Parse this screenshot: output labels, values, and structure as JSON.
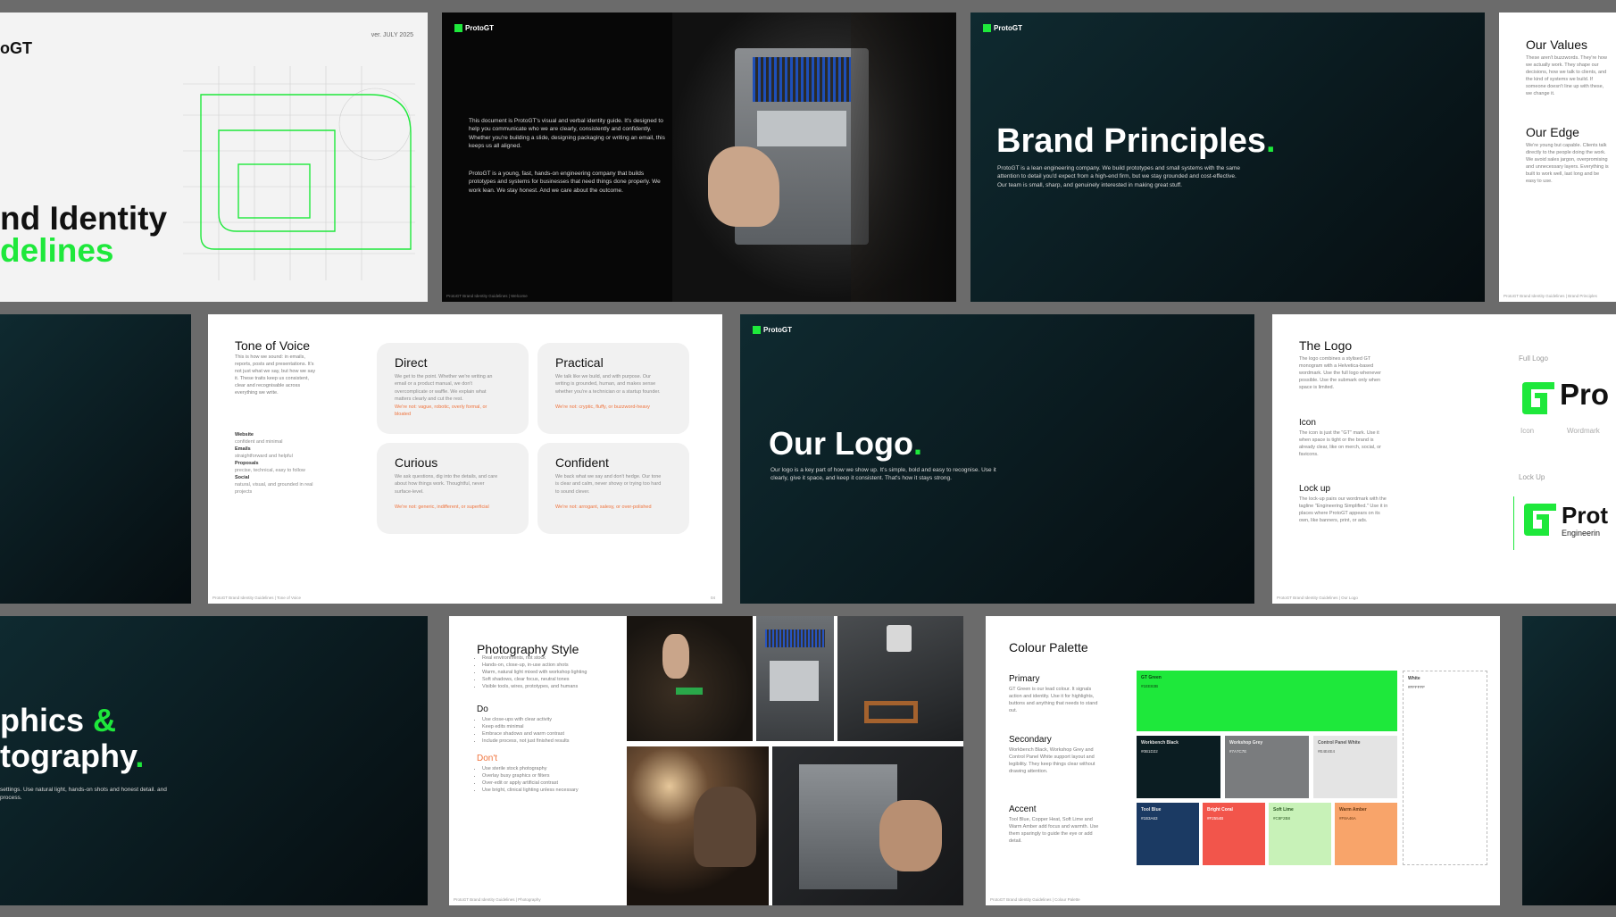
{
  "cover": {
    "logo_fragment": "oGT",
    "version": "ver. JULY 2025",
    "title_line1": "nd Identity",
    "title_line2": "delines"
  },
  "intro": {
    "logo": "ProtoGT",
    "para1": "This document is ProtoGT's visual and verbal identity guide. It's designed to help you communicate who we are clearly, consistently and confidently. Whether you're building a slide, designing packaging or writing an email, this keeps us all aligned.",
    "para2": "ProtoGT is a young, fast, hands-on engineering company that builds prototypes and systems for businesses that need things done properly. We work lean. We stay honest. And we care about the outcome.",
    "footer": "ProtoGT Brand Identity Guidelines | Welcome"
  },
  "principles": {
    "logo": "ProtoGT",
    "title": "Brand Principles",
    "dot": ".",
    "body": "ProtoGT is a lean engineering company. We build prototypes and small systems with the same attention to detail you'd expect from a high-end firm, but we stay grounded and cost-effective. Our team is small, sharp, and genuinely interested in making great stuff."
  },
  "values": {
    "h1": "Our Values",
    "p1": "These aren't buzzwords. They're how we actually work. They shape our decisions, how we talk to clients, and the kind of systems we build. If someone doesn't line up with these, we change it.",
    "h2": "Our Edge",
    "p2": "We're young but capable. Clients talk directly to the people doing the work. We avoid sales jargon, overpromising and unnecessary layers. Everything is built to work well, last long and be easy to use.",
    "footer": "ProtoGT Brand Identity Guidelines | Brand Principles"
  },
  "tone": {
    "title": "Tone of Voice",
    "intro": "This is how we sound: in emails, reports, posts and presentations. It's not just what we say, but how we say it. These traits keep us consistent, clear and recognisable across everything we write.",
    "channels": [
      {
        "name": "Website",
        "desc": "confident and minimal"
      },
      {
        "name": "Emails",
        "desc": "straightforward and helpful"
      },
      {
        "name": "Proposals",
        "desc": "precise, technical, easy to follow"
      },
      {
        "name": "Social",
        "desc": "natural, visual, and grounded in real projects"
      }
    ],
    "cards": [
      {
        "title": "Direct",
        "desc": "We get to the point. Whether we're writing an email or a product manual, we don't overcomplicate or waffle. We explain what matters clearly and cut the rest.",
        "not": "We're not: vague, robotic, overly formal, or bloated"
      },
      {
        "title": "Practical",
        "desc": "We talk like we build, and with purpose. Our writing is grounded, human, and makes sense whether you're a technician or a startup founder.",
        "not": "We're not: cryptic, fluffy, or buzzword-heavy"
      },
      {
        "title": "Curious",
        "desc": "We ask questions, dig into the details, and care about how things work. Thoughtful, never surface-level.",
        "not": "We're not: generic, indifferent, or superficial"
      },
      {
        "title": "Confident",
        "desc": "We back what we say and don't hedge. Our tone is clear and calm, never showy or trying too hard to sound clever.",
        "not": "We're not: arrogant, salesy, or over-polished"
      }
    ],
    "footer": "ProtoGT Brand Identity Guidelines | Tone of Voice",
    "page": "04"
  },
  "ourlogo": {
    "logo": "ProtoGT",
    "title": "Our Logo",
    "dot": ".",
    "body": "Our logo is a key part of how we show up. It's simple, bold and easy to recognise. Use it clearly, give it space, and keep it consistent. That's how it stays strong."
  },
  "thelogo": {
    "title": "The Logo",
    "p1": "The logo combines a stylised GT monogram with a Helvetica-based wordmark. Use the full logo whenever possible. Use the submark only when space is limited.",
    "icon_h": "Icon",
    "icon_p": "The icon is just the \"GT\" mark. Use it when space is tight or the brand is already clear, like on merch, social, or favicons.",
    "lockup_h": "Lock up",
    "lockup_p": "The lock-up pairs our wordmark with the tagline \"Engineering Simplified.\" Use it in places where ProtoGT appears on its own, like banners, print, or ads.",
    "full_logo_label": "Full Logo",
    "mark_text": "Pro",
    "icon_label": "Icon",
    "wordmark_label": "Wordmark",
    "lockup_label": "Lock Up",
    "lockup_text": "Prot",
    "lockup_tag": "Engineerin",
    "footer": "ProtoGT Brand Identity Guidelines | Our Logo"
  },
  "graphics": {
    "line1": "phics ",
    "amp": "&",
    "line2": "tography",
    "dot": ".",
    "body": "settings. Use natural light, hands-on shots and honest detail. and process."
  },
  "photography": {
    "title": "Photography Style",
    "list1": [
      "Real environments, not stock",
      "Hands-on, close-up, in-use action shots",
      "Warm, natural light mixed with workshop lighting",
      "Soft shadows, clear focus, neutral tones",
      "Visible tools, wires, prototypes, and humans"
    ],
    "do_h": "Do",
    "list2": [
      "Use close-ups with clear activity",
      "Keep edits minimal",
      "Embrace shadows and warm contrast",
      "Include process, not just finished results"
    ],
    "dont_h": "Don't",
    "list3": [
      "Use sterile stock photography",
      "Overlay busy graphics or filters",
      "Over-edit or apply artificial contrast",
      "Use bright, clinical lighting unless necessary"
    ],
    "footer": "ProtoGT Brand Identity Guidelines | Photography"
  },
  "palette": {
    "title": "Colour Palette",
    "primary_h": "Primary",
    "primary_p": "GT Green is our lead colour. It signals action and identity. Use it for highlights, buttons and anything that needs to stand out.",
    "secondary_h": "Secondary",
    "secondary_p": "Workbench Black, Workshop Grey and Control Panel White support layout and legibility. They keep things clear without drawing attention.",
    "accent_h": "Accent",
    "accent_p": "Tool Blue, Copper Heat, Soft Lime and Warm Amber add focus and warmth. Use them sparingly to guide the eye or add detail.",
    "swatches": {
      "gtgreen": {
        "name": "GT Green",
        "codes": "#1EE83B"
      },
      "white": {
        "name": "White",
        "codes": "#FFFFFF"
      },
      "workbench": {
        "name": "Workbench Black",
        "codes": "#0B1D22"
      },
      "workshop": {
        "name": "Workshop Grey",
        "codes": "#7A7C7E"
      },
      "control": {
        "name": "Control Panel White",
        "codes": "#E4E4E4"
      },
      "toolblue": {
        "name": "Tool Blue",
        "codes": "#1B3A63"
      },
      "copper": {
        "name": "Bright Coral",
        "codes": "#F2554B"
      },
      "lime": {
        "name": "Soft Lime",
        "codes": "#C8F2B8"
      },
      "amber": {
        "name": "Warm Amber",
        "codes": "#F8A46A"
      }
    },
    "footer": "ProtoGT Brand Identity Guidelines | Colour Palette"
  },
  "colors": {
    "green": "#1ee83b",
    "dark": "#0b1d22",
    "coral": "#f0733c"
  }
}
